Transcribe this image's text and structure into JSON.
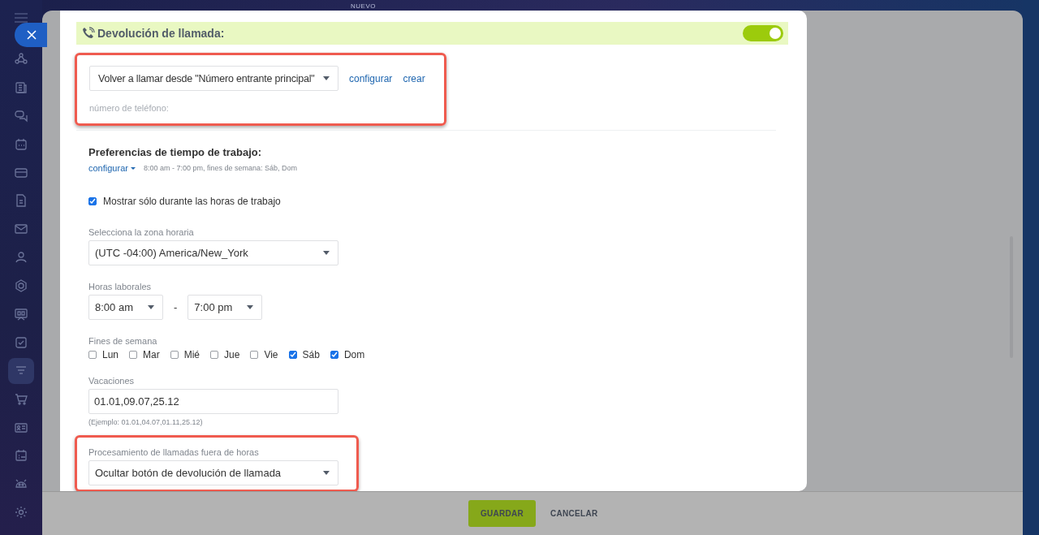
{
  "sidebar": {
    "items": [
      {
        "kind": "flow",
        "selected": false
      },
      {
        "kind": "doc",
        "selected": false
      },
      {
        "kind": "chat",
        "selected": false
      },
      {
        "kind": "calendar",
        "selected": false
      },
      {
        "kind": "card",
        "selected": false
      },
      {
        "kind": "file",
        "selected": false
      },
      {
        "kind": "mail",
        "selected": false
      },
      {
        "kind": "people",
        "selected": false
      },
      {
        "kind": "hexagon",
        "selected": false
      },
      {
        "kind": "board",
        "selected": false
      },
      {
        "kind": "check",
        "selected": false
      },
      {
        "kind": "funnel",
        "selected": true
      },
      {
        "kind": "cart",
        "selected": false
      },
      {
        "kind": "contact",
        "selected": false
      },
      {
        "kind": "schedule",
        "selected": false
      },
      {
        "kind": "robot",
        "selected": false
      },
      {
        "kind": "gear",
        "selected": false
      }
    ]
  },
  "badge": "NUEVO",
  "callback": {
    "title": "Devolución de llamada:",
    "enabled": true,
    "highlighted": true,
    "source_select": "Volver a llamar desde \"Número entrante principal\"",
    "links": [
      "configurar",
      "crear"
    ],
    "phone_label": "número de teléfono:"
  },
  "work_time": {
    "title": "Preferencias de tiempo de trabajo:",
    "configure_link": "configurar",
    "summary": "8:00 am - 7:00 pm, fines de semana: Sáb, Dom"
  },
  "show_only_work_hours": {
    "label": "Mostrar sólo durante las horas de trabajo",
    "checked": true
  },
  "timezone": {
    "label": "Selecciona la zona horaria",
    "value": "(UTC -04:00) America/New_York"
  },
  "hours": {
    "label": "Horas laborales",
    "from": "8:00 am",
    "separator": "-",
    "to": "7:00 pm"
  },
  "weekends": {
    "label": "Fines de semana",
    "days": [
      {
        "label": "Lun",
        "checked": false
      },
      {
        "label": "Mar",
        "checked": false
      },
      {
        "label": "Mié",
        "checked": false
      },
      {
        "label": "Jue",
        "checked": false
      },
      {
        "label": "Vie",
        "checked": false
      },
      {
        "label": "Sáb",
        "checked": true
      },
      {
        "label": "Dom",
        "checked": true
      }
    ]
  },
  "holidays": {
    "label": "Vacaciones",
    "value": "01.01,09.07,25.12",
    "hint": "(Ejemplo: 01.01,04.07,01.11,25.12)"
  },
  "after_hours": {
    "label": "Procesamiento de llamadas fuera de horas",
    "value": "Ocultar botón de devolución de llamada",
    "highlighted": true
  },
  "buttons": [
    {
      "label": "GUARDAR",
      "kind": "primary"
    },
    {
      "label": "CANCELAR",
      "kind": "secondary"
    }
  ]
}
